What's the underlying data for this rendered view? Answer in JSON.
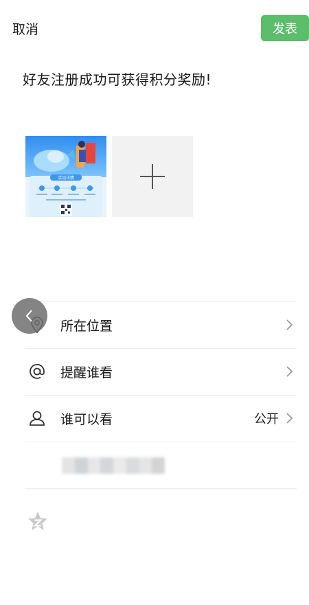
{
  "header": {
    "cancel_label": "取消",
    "publish_label": "发表"
  },
  "post": {
    "text": "好友注册成功可获得积分奖励!"
  },
  "images": {
    "thumbnail_caption": "活动详情",
    "add_icon": "plus-icon"
  },
  "options": {
    "location": {
      "label": "所在位置",
      "icon": "location-pin-icon"
    },
    "remind": {
      "label": "提醒谁看",
      "icon": "at-icon"
    },
    "visibility": {
      "label": "谁可以看",
      "value": "公开",
      "icon": "person-icon"
    }
  },
  "colors": {
    "accent": "#5cbd6a",
    "divider": "#ececec",
    "icon": "#333333",
    "chevron": "#9a9a9a"
  }
}
